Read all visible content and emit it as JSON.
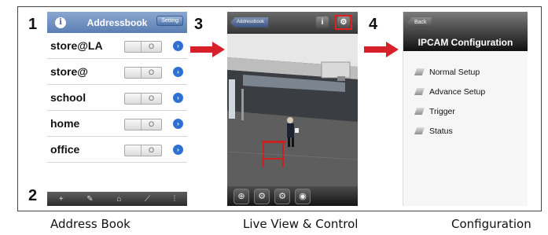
{
  "steps": [
    "1",
    "2",
    "3",
    "4"
  ],
  "captions": [
    "Address Book",
    "Live View & Control",
    "Configuration"
  ],
  "colors": {
    "arrow": "#d6202a",
    "highlight": "#e02020",
    "disclosure": "#2f71d2"
  },
  "addressbook": {
    "title": "Addressbook",
    "info_icon": "i",
    "setting_label": "Setting",
    "toggle_text": "O",
    "disclosure_icon": "chevron-right-icon",
    "entries": [
      "store@LA",
      "store@",
      "school",
      "home",
      "office"
    ],
    "toolbar_icons": [
      "+",
      "✎",
      "⌂",
      "⟋",
      "⫶"
    ]
  },
  "liveview": {
    "back_label": "Addressbook",
    "info_icon": "i",
    "settings_icon": "⚙",
    "controls": [
      "⊕",
      "⚙",
      "⚙",
      "◉"
    ]
  },
  "config": {
    "back_label": "Back",
    "title": "IPCAM Configuration",
    "items": [
      "Normal Setup",
      "Advance Setup",
      "Trigger",
      "Status"
    ]
  }
}
